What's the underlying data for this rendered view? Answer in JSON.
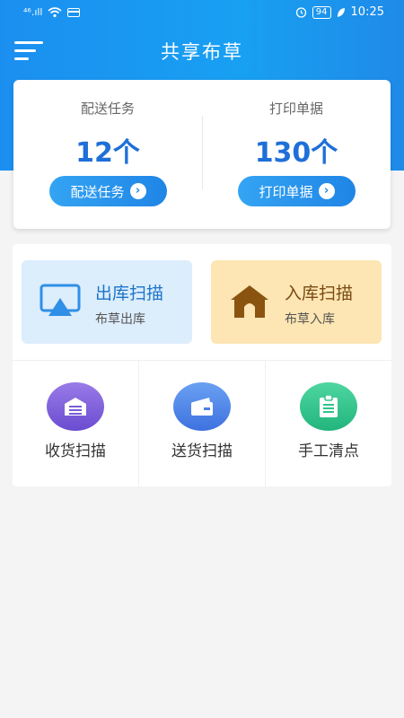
{
  "status_bar": {
    "left_text": "⁴⁶.ıll",
    "battery": "94",
    "time": "10:25"
  },
  "header": {
    "title": "共享布草"
  },
  "summary": [
    {
      "label": "配送任务",
      "value": "12个",
      "button": "配送任务"
    },
    {
      "label": "打印单据",
      "value": "130个",
      "button": "打印单据"
    }
  ],
  "scan": {
    "out": {
      "title": "出库扫描",
      "subtitle": "布草出库",
      "icon": "display-upload-icon"
    },
    "in": {
      "title": "入库扫描",
      "subtitle": "布草入库",
      "icon": "house-icon"
    }
  },
  "functions": [
    {
      "label": "收货扫描",
      "icon": "warehouse-icon",
      "color": "#7b5cd6"
    },
    {
      "label": "送货扫描",
      "icon": "wallet-icon",
      "color": "#4b7fe6"
    },
    {
      "label": "手工清点",
      "icon": "clipboard-icon",
      "color": "#2ec38a"
    }
  ],
  "colors": {
    "primary": "#1b8ff0",
    "value_blue": "#1f6fd8",
    "background": "#f4f4f4"
  }
}
